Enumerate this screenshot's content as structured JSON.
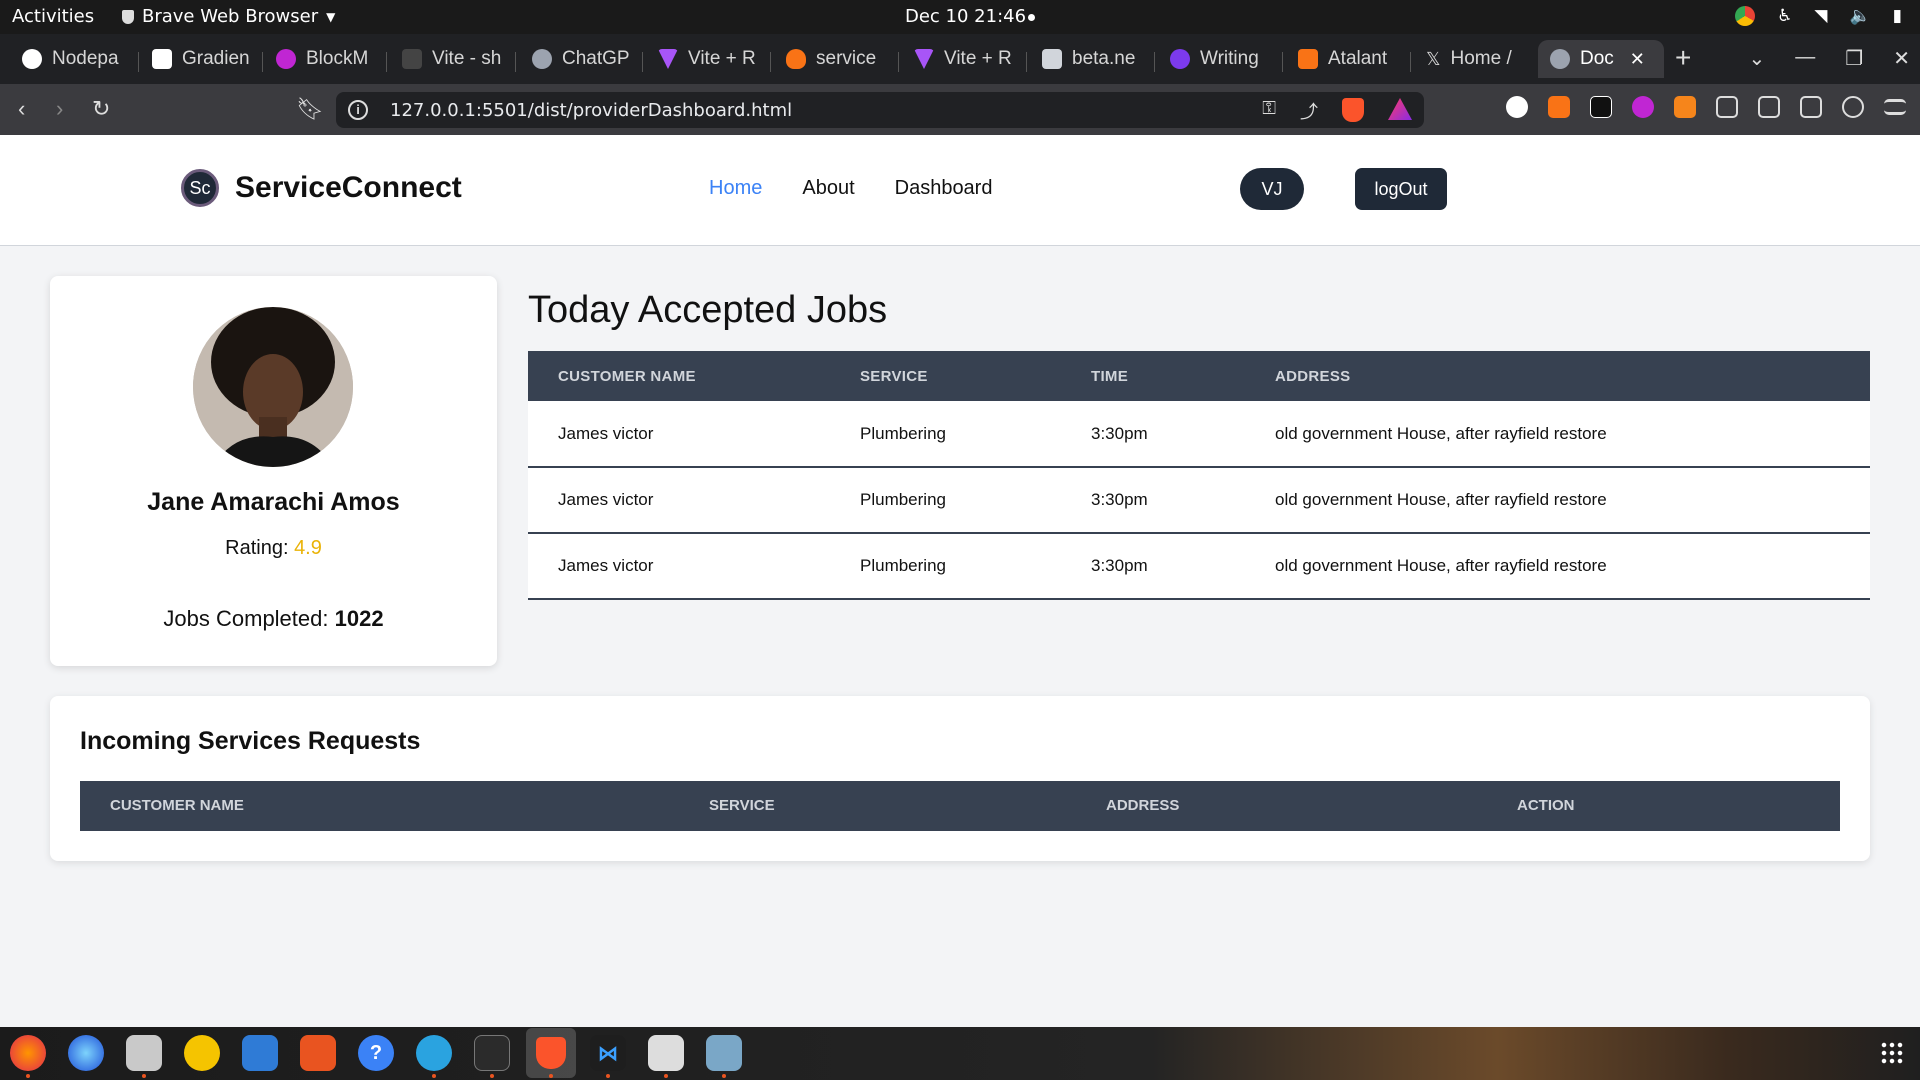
{
  "system": {
    "activities": "Activities",
    "app_name": "Brave Web Browser",
    "clock": "Dec 10  21:46"
  },
  "tabs": [
    {
      "label": "Nodepa",
      "color": "#ffffff"
    },
    {
      "label": "Gradien",
      "color": "#111111"
    },
    {
      "label": "BlockM",
      "color": "#c026d3"
    },
    {
      "label": "Vite - sh",
      "color": "#444444"
    },
    {
      "label": "ChatGP",
      "color": "#9ca3af"
    },
    {
      "label": "Vite + R",
      "color": "#a855f7"
    },
    {
      "label": "service",
      "color": "#f97316"
    },
    {
      "label": "Vite + R",
      "color": "#a855f7"
    },
    {
      "label": "beta.ne",
      "color": "#d1d5db"
    },
    {
      "label": "Writing",
      "color": "#7c3aed"
    },
    {
      "label": "Atalant",
      "color": "#f97316"
    },
    {
      "label": "Home /",
      "color": "#000000"
    },
    {
      "label": "Doc",
      "color": "#9ca3af"
    }
  ],
  "browser": {
    "url": "127.0.0.1:5501/dist/providerDashboard.html",
    "rewards_count": "1"
  },
  "site": {
    "brand_logo": "Sc",
    "brand_name": "ServiceConnect",
    "nav": {
      "home": "Home",
      "about": "About",
      "dashboard": "Dashboard"
    },
    "user_initials": "VJ",
    "logout_label": "logOut",
    "accent_color": "#3b82f6",
    "dark_color": "#1f2937"
  },
  "profile": {
    "name": "Jane Amarachi Amos",
    "rating_label": "Rating:",
    "rating_value": "4.9",
    "jobs_label": "Jobs Completed:",
    "jobs_value": "1022"
  },
  "accepted_jobs": {
    "title": "Today Accepted Jobs",
    "columns": [
      "Customer Name",
      "Service",
      "Time",
      "Address"
    ],
    "rows": [
      [
        "James victor",
        "Plumbering",
        "3:30pm",
        "old government House, after rayfield restore"
      ],
      [
        "James victor",
        "Plumbering",
        "3:30pm",
        "old government House, after rayfield restore"
      ],
      [
        "James victor",
        "Plumbering",
        "3:30pm",
        "old government House, after rayfield restore"
      ]
    ]
  },
  "incoming_requests": {
    "title": "Incoming Services Requests",
    "columns": [
      "Customer Name",
      "Service",
      "Address",
      "Action"
    ]
  }
}
